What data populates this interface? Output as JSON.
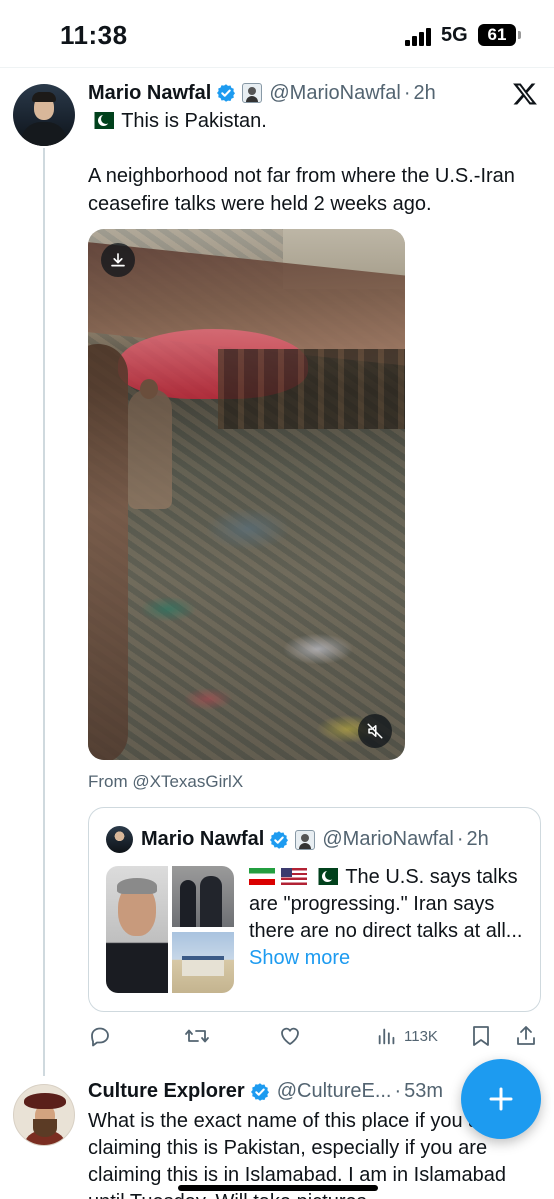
{
  "status_bar": {
    "time": "11:38",
    "network": "5G",
    "battery": "61"
  },
  "tweet": {
    "author_name": "Mario Nawfal",
    "handle": "@MarioNawfal",
    "separator": "·",
    "time": "2h",
    "line1": "This is Pakistan.",
    "body": "A neighborhood not far from where the U.S.-Iran ceasefire talks were held 2 weeks ago.",
    "from_text": "From @XTexasGirlX"
  },
  "quote": {
    "author_name": "Mario Nawfal",
    "handle": "@MarioNawfal",
    "separator": "·",
    "time": "2h",
    "text": " The U.S. says talks are \"progressing.\" Iran says there are no direct talks at all...",
    "show_more": " Show more"
  },
  "actions": {
    "views": "113K"
  },
  "reply": {
    "author_name": "Culture Explorer",
    "handle": "@CultureE...",
    "separator": "·",
    "time": "53m",
    "body": "What is the exact name of this place if you are claiming this is Pakistan, especially if you are claiming this is in Islamabad. I am in Islamabad until Tuesday. Will take pictures"
  },
  "colors": {
    "accent": "#1d9bf0",
    "verified": "#1d9bf0",
    "muted_text": "#536471"
  },
  "icons": [
    "x-logo-icon",
    "verified-badge-icon",
    "affiliate-badge-icon",
    "download-icon",
    "mute-icon",
    "reply-icon",
    "retweet-icon",
    "like-icon",
    "views-icon",
    "bookmark-icon",
    "share-icon",
    "compose-plus-icon"
  ]
}
